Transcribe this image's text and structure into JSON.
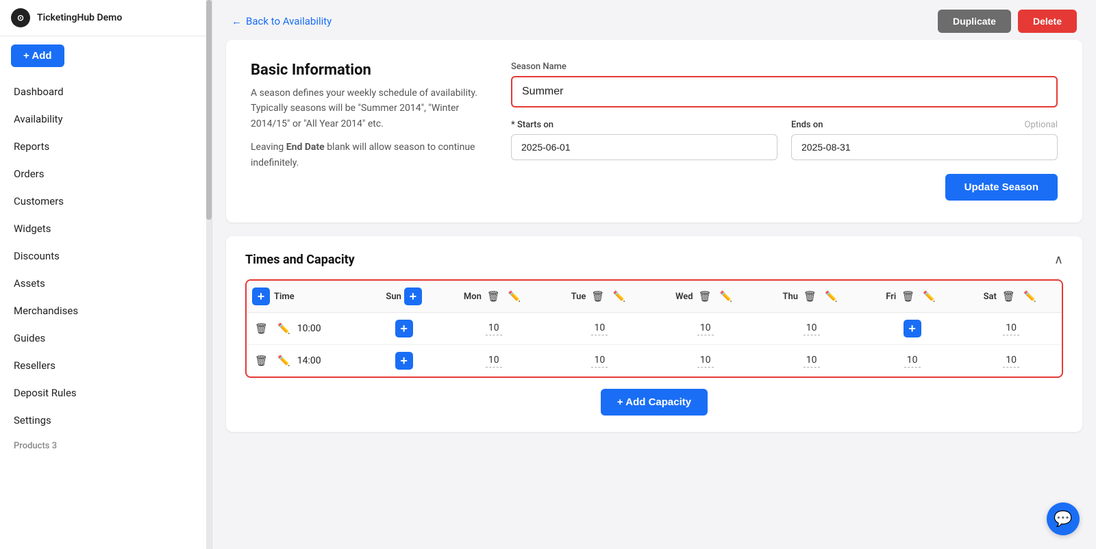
{
  "app": {
    "name": "TicketingHub Demo"
  },
  "sidebar": {
    "add_button": "+ Add",
    "nav_items": [
      {
        "label": "Dashboard",
        "id": "dashboard"
      },
      {
        "label": "Availability",
        "id": "availability"
      },
      {
        "label": "Reports",
        "id": "reports"
      },
      {
        "label": "Orders",
        "id": "orders"
      },
      {
        "label": "Customers",
        "id": "customers"
      },
      {
        "label": "Widgets",
        "id": "widgets"
      },
      {
        "label": "Discounts",
        "id": "discounts"
      },
      {
        "label": "Assets",
        "id": "assets"
      },
      {
        "label": "Merchandises",
        "id": "merchandises"
      },
      {
        "label": "Guides",
        "id": "guides"
      },
      {
        "label": "Resellers",
        "id": "resellers"
      },
      {
        "label": "Deposit Rules",
        "id": "deposit-rules"
      },
      {
        "label": "Settings",
        "id": "settings"
      }
    ],
    "products_label": "Products 3"
  },
  "topbar": {
    "back_link": "Back to Availability",
    "duplicate_btn": "Duplicate",
    "delete_btn": "Delete"
  },
  "basic_info": {
    "title": "Basic Information",
    "description": "A season defines your weekly schedule of availability. Typically seasons will be \"Summer 2014\", \"Winter 2014/15\" or \"All Year 2014\" etc.",
    "end_date_note": "Leaving End Date blank will allow season to continue indefinitely.",
    "end_date_bold": "End Date",
    "season_name_label": "Season Name",
    "season_name_value": "Summer",
    "starts_on_label": "* Starts on",
    "starts_on_value": "2025-06-01",
    "ends_on_label": "Ends on",
    "ends_on_value": "2025-08-31",
    "ends_on_optional": "Optional",
    "update_season_btn": "Update Season"
  },
  "times_capacity": {
    "title": "Times and Capacity",
    "columns": [
      "Time",
      "Sun",
      "Mon",
      "Tue",
      "Wed",
      "Thu",
      "Fri",
      "Sat"
    ],
    "rows": [
      {
        "time": "10:00",
        "sun": "+",
        "mon": "10",
        "tue": "10",
        "wed": "10",
        "thu": "10",
        "fri": "+",
        "sat": "10"
      },
      {
        "time": "14:00",
        "sun": "+",
        "mon": "10",
        "tue": "10",
        "wed": "10",
        "thu": "10",
        "fri": "10",
        "sat": "10"
      }
    ],
    "add_capacity_btn": "+ Add Capacity"
  },
  "chat_bubble": {
    "icon": "💬"
  }
}
